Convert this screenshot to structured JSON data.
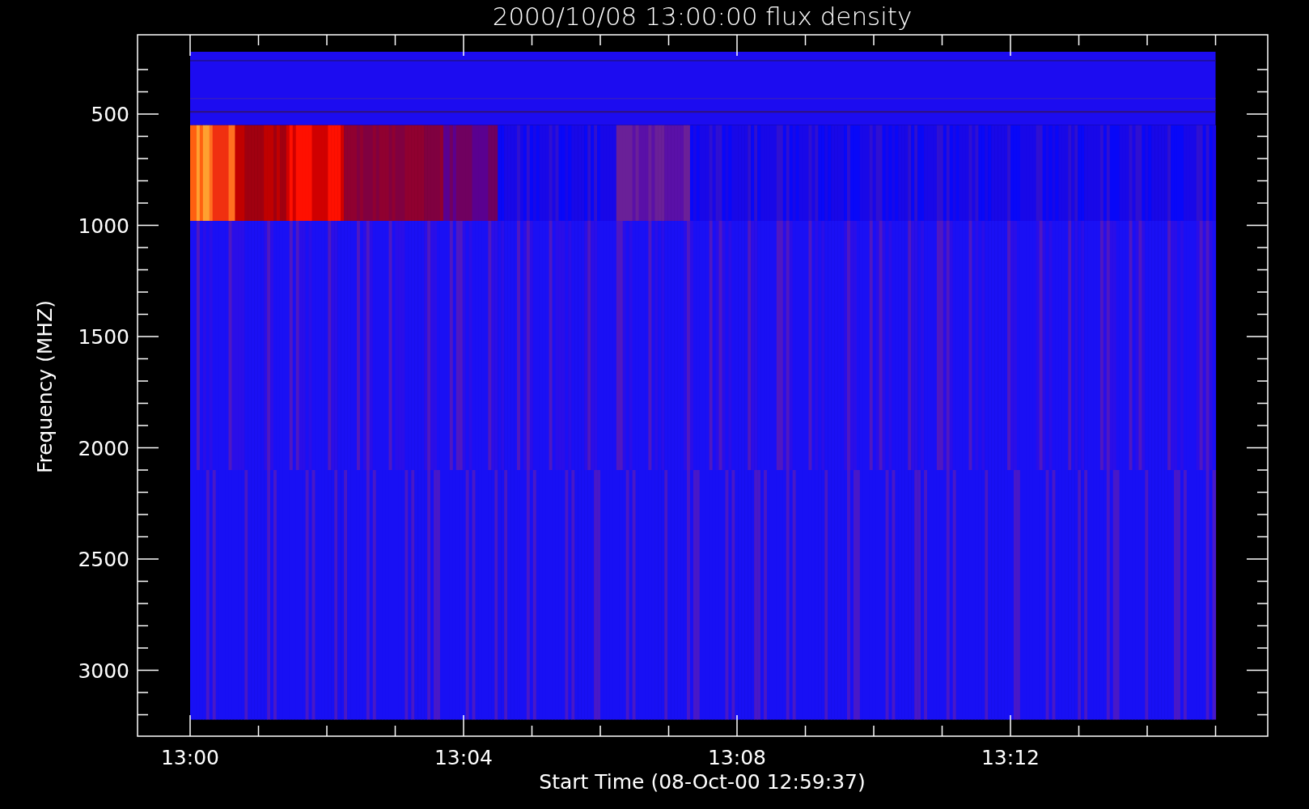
{
  "plot": {
    "title": "2000/10/08 13:00:00 flux density",
    "xlabel": "Start Time (08-Oct-00 12:59:37)",
    "ylabel": "Frequency (MHZ)",
    "x_tick_labels": [
      "13:00",
      "13:04",
      "13:08",
      "13:12"
    ],
    "y_tick_labels": [
      "500",
      "1000",
      "1500",
      "2000",
      "2500",
      "3000"
    ]
  }
}
